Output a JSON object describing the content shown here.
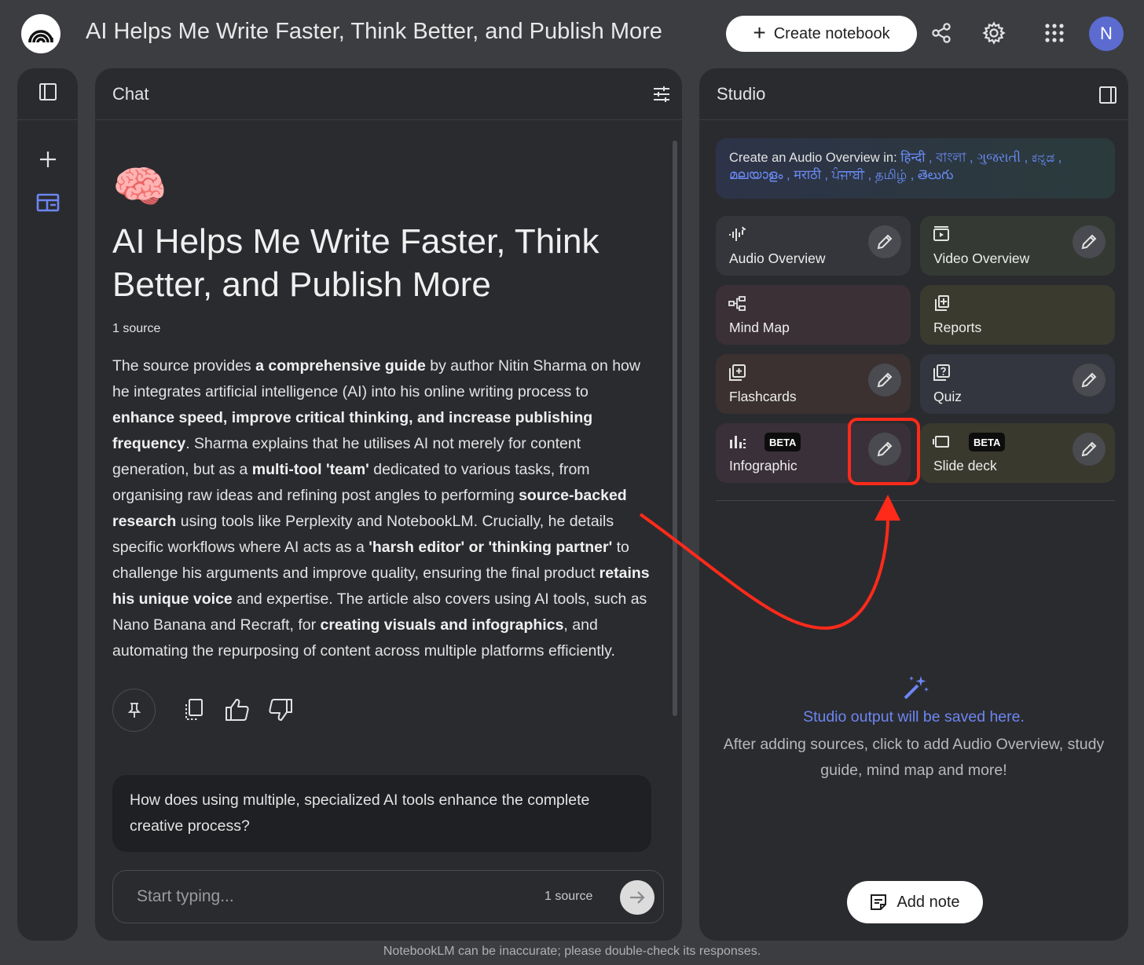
{
  "header": {
    "title": "AI Helps Me Write Faster, Think Better, and Publish More",
    "create_label": "Create notebook",
    "avatar_letter": "N"
  },
  "chat": {
    "panel_title": "Chat",
    "notebook_title": "AI Helps Me Write Faster, Think Better, and Publish More",
    "emoji": "🧠",
    "source_count": "1 source",
    "summary_segments": [
      {
        "t": "The source provides ",
        "b": false
      },
      {
        "t": "a comprehensive guide",
        "b": true
      },
      {
        "t": " by author Nitin Sharma on how he integrates artificial intelligence (AI) into his online writing process to ",
        "b": false
      },
      {
        "t": "enhance speed, improve critical thinking, and increase publishing frequency",
        "b": true
      },
      {
        "t": ". Sharma explains that he utilises AI not merely for content generation, but as a ",
        "b": false
      },
      {
        "t": "multi-tool 'team'",
        "b": true
      },
      {
        "t": " dedicated to various tasks, from organising raw ideas and refining post angles to performing ",
        "b": false
      },
      {
        "t": "source-backed research",
        "b": true
      },
      {
        "t": " using tools like Perplexity and NotebookLM. Crucially, he details specific workflows where AI acts as a ",
        "b": false
      },
      {
        "t": "'harsh editor' or 'thinking partner'",
        "b": true
      },
      {
        "t": " to challenge his arguments and improve quality, ensuring the final product ",
        "b": false
      },
      {
        "t": "retains his unique voice",
        "b": true
      },
      {
        "t": " and expertise. The article also covers using AI tools, such as Nano Banana and Recraft, for ",
        "b": false
      },
      {
        "t": "creating visuals and infographics",
        "b": true
      },
      {
        "t": ", and automating the repurposing of content across multiple platforms efficiently.",
        "b": false
      }
    ],
    "suggestion": "How does using multiple, specialized AI tools enhance the complete creative process?",
    "input_placeholder": "Start typing...",
    "input_source_count": "1 source"
  },
  "studio": {
    "panel_title": "Studio",
    "audio_banner_label": "Create an Audio Overview in:",
    "languages": [
      "हिन्दी",
      "বাংলা",
      "ગુજરાતી",
      "ಕನ್ನಡ",
      "മലയാളം",
      "मराठी",
      "ਪੰਜਾਬੀ",
      "தமிழ்",
      "తెలుగు"
    ],
    "tiles": [
      {
        "label": "Audio Overview",
        "icon": "audio-waveform-icon",
        "bg": "#35363b",
        "edit": true
      },
      {
        "label": "Video Overview",
        "icon": "video-icon",
        "bg": "#343a33",
        "edit": true
      },
      {
        "label": "Mind Map",
        "icon": "mind-map-icon",
        "bg": "#3b3036",
        "edit": false
      },
      {
        "label": "Reports",
        "icon": "reports-icon",
        "bg": "#3a3a2e",
        "edit": false
      },
      {
        "label": "Flashcards",
        "icon": "flashcards-icon",
        "bg": "#3a3130",
        "edit": true
      },
      {
        "label": "Quiz",
        "icon": "quiz-icon",
        "bg": "#33363e",
        "edit": true
      },
      {
        "label": "Infographic",
        "icon": "infographic-icon",
        "bg": "#3a3039",
        "edit": true,
        "beta": "BETA"
      },
      {
        "label": "Slide deck",
        "icon": "slide-deck-icon",
        "bg": "#39392e",
        "edit": true,
        "beta": "BETA"
      }
    ],
    "empty_title": "Studio output will be saved here.",
    "empty_desc": "After adding sources, click to add Audio Overview, study guide, mind map and more!",
    "add_note_label": "Add note"
  },
  "footer": "NotebookLM can be inaccurate; please double-check its responses.",
  "colors": {
    "accent": "#6d86f2",
    "annotation": "#ff2a1a"
  }
}
